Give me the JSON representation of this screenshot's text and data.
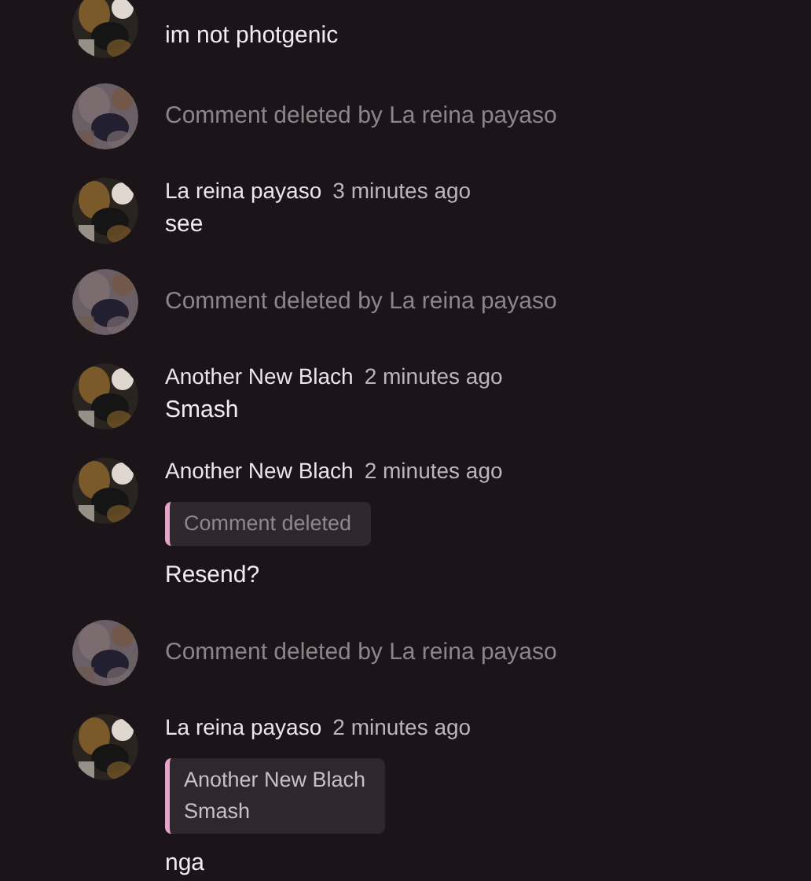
{
  "comments": [
    {
      "kind": "message",
      "text": "im not photgenic"
    },
    {
      "kind": "deleted",
      "text": "Comment deleted by La reina payaso"
    },
    {
      "kind": "message",
      "author": "La reina payaso",
      "time": "3 minutes ago",
      "text": "see"
    },
    {
      "kind": "deleted",
      "text": "Comment deleted by La reina payaso"
    },
    {
      "kind": "message",
      "author": "Another New Blach",
      "time": "2 minutes ago",
      "text": "Smash"
    },
    {
      "kind": "message",
      "author": "Another New Blach",
      "time": "2 minutes ago",
      "reply": {
        "deleted": true,
        "text": "Comment deleted"
      },
      "text": "Resend?"
    },
    {
      "kind": "deleted",
      "text": "Comment deleted by La reina payaso"
    },
    {
      "kind": "message",
      "author": "La reina payaso",
      "time": "2 minutes ago",
      "reply": {
        "deleted": false,
        "author": "Another New Blach",
        "text": "Smash"
      },
      "text": "nga"
    }
  ]
}
